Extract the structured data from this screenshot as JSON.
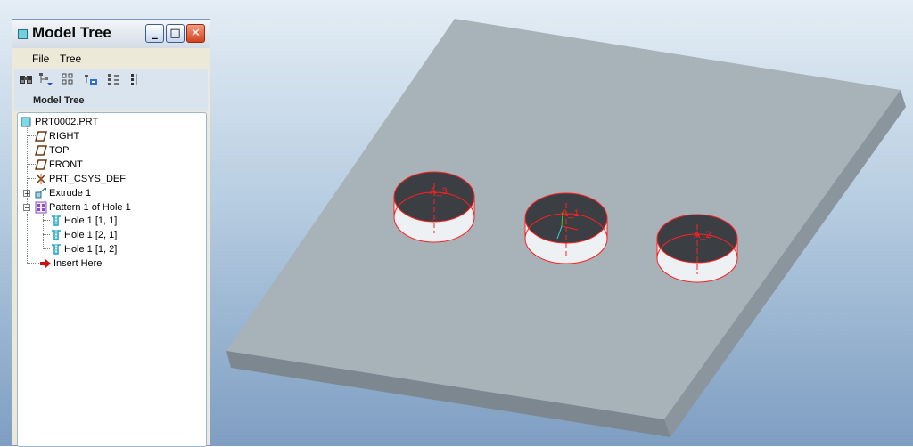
{
  "window": {
    "title": "Model Tree",
    "minimize_glyph": "_",
    "maximize_glyph": "□",
    "close_glyph": "✕"
  },
  "menu": [
    "File",
    "Tree"
  ],
  "toolbar_icons": [
    "find-icon",
    "settings-icon",
    "show-icon",
    "filter-icon",
    "expand-all-icon",
    "collapse-all-icon"
  ],
  "panel_label": "Model Tree",
  "tree": {
    "root": "PRT0002.PRT",
    "right": "RIGHT",
    "top": "TOP",
    "front": "FRONT",
    "csys": "PRT_CSYS_DEF",
    "extrude": "Extrude 1",
    "pattern": "Pattern 1 of Hole 1",
    "holes": [
      "Hole 1 [1, 1]",
      "Hole 1 [2, 1]",
      "Hole 1 [1, 2]"
    ],
    "insert": "Insert Here"
  },
  "viewport": {
    "axis_labels": [
      "A_3",
      "A_1",
      "A_2"
    ]
  },
  "colors": {
    "plate_top": "#a8b2b9",
    "plate_edge": "#7d878f",
    "hole_edge": "#ff2020",
    "datum_plane": "#6b3a10",
    "insert_arrow": "#d01010"
  }
}
